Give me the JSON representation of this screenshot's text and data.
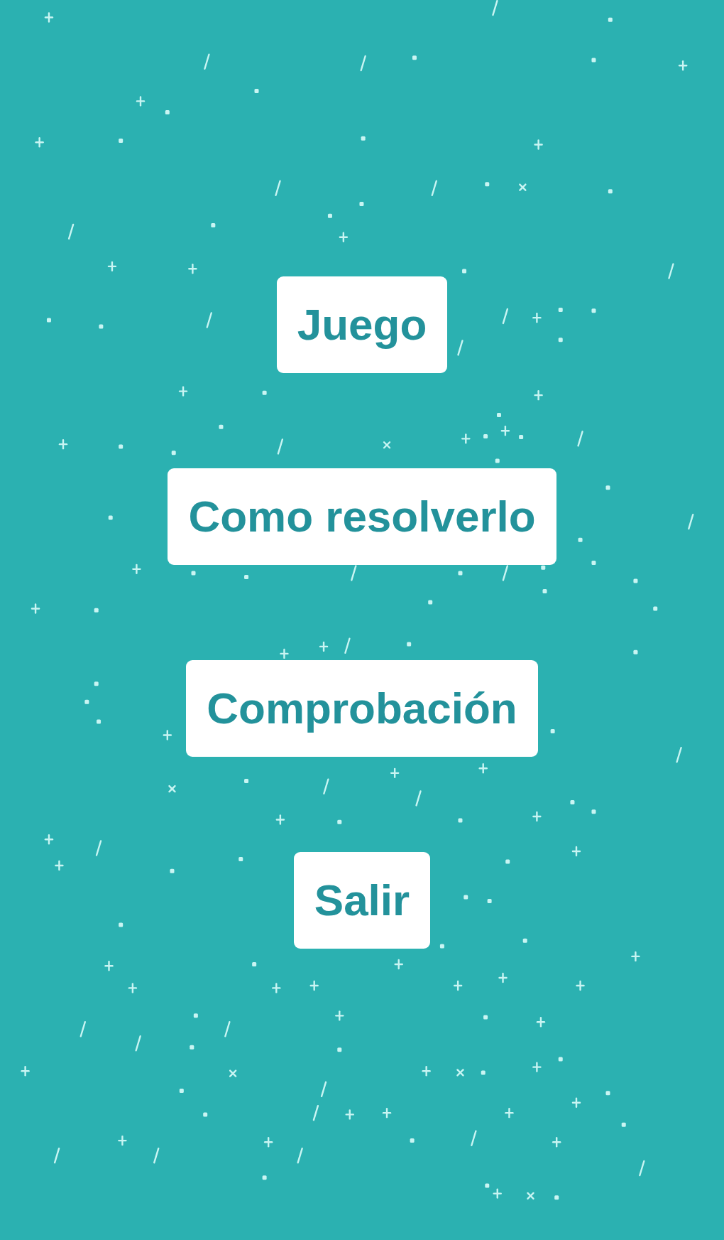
{
  "menu": {
    "buttons": [
      {
        "label": "Juego"
      },
      {
        "label": "Como resolverlo"
      },
      {
        "label": "Comprobación"
      },
      {
        "label": "Salir"
      }
    ]
  }
}
